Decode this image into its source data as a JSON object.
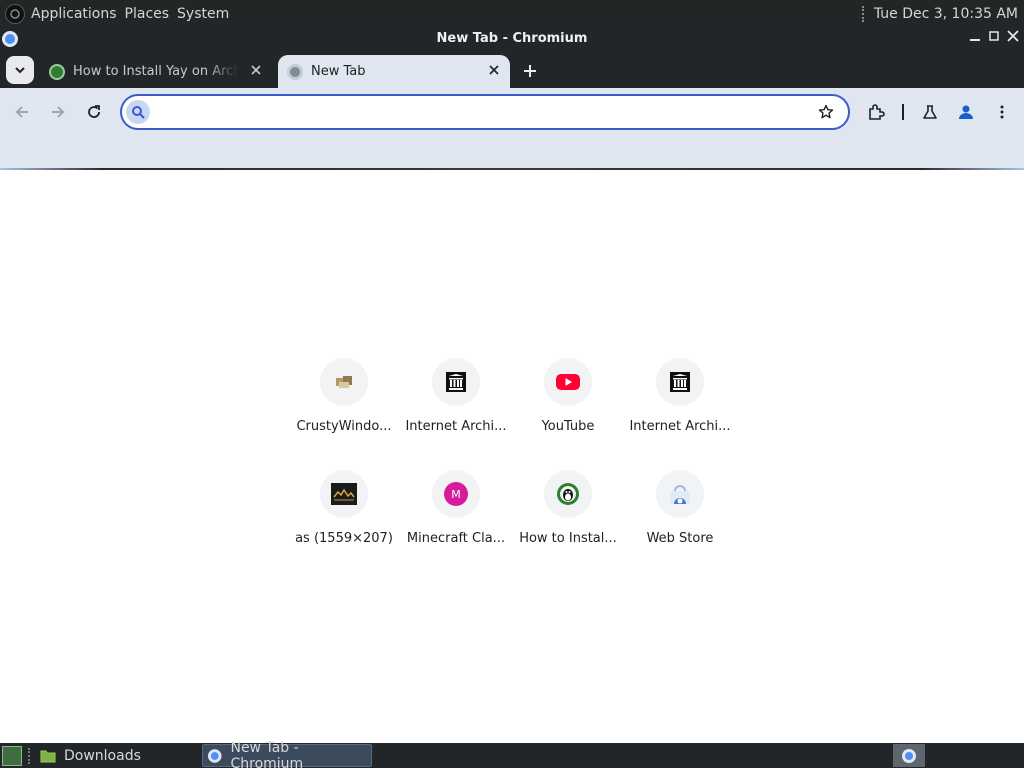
{
  "desktop_panel": {
    "menus": [
      "Applications",
      "Places",
      "System"
    ],
    "clock": "Tue Dec  3, 10:35 AM"
  },
  "window": {
    "title": "New Tab - Chromium"
  },
  "tabs": [
    {
      "label": "How to Install Yay on Arch Linux",
      "favicon": "site-favicon-icon",
      "active": false
    },
    {
      "label": "New Tab",
      "favicon": "chromium-favicon-icon",
      "active": true
    }
  ],
  "omnibox": {
    "value": "",
    "placeholder": ""
  },
  "shortcuts": [
    {
      "title": "CrustyWindo...",
      "icon": "crustywindows-icon"
    },
    {
      "title": "Internet Archi...",
      "icon": "internet-archive-icon"
    },
    {
      "title": "YouTube",
      "icon": "youtube-icon"
    },
    {
      "title": "Internet Archi...",
      "icon": "internet-archive-icon"
    },
    {
      "title": "as (1559×207)",
      "icon": "image-thumbnail-icon"
    },
    {
      "title": "Minecraft Cla...",
      "icon": "letter-m-icon"
    },
    {
      "title": "How to Instal...",
      "icon": "linux-tux-icon"
    },
    {
      "title": "Web Store",
      "icon": "web-store-icon"
    }
  ],
  "taskbar": {
    "items": [
      {
        "label": "Downloads",
        "icon": "folder-icon"
      },
      {
        "label": "New Tab - Chromium",
        "icon": "chromium-icon"
      }
    ]
  },
  "colors": {
    "panel_bg": "#232627",
    "toolbar_bg": "#dfe6ef",
    "omnibox_focus": "#3c5bd0",
    "youtube_red": "#ff0033",
    "minecraft_pink": "#d81b9c"
  }
}
